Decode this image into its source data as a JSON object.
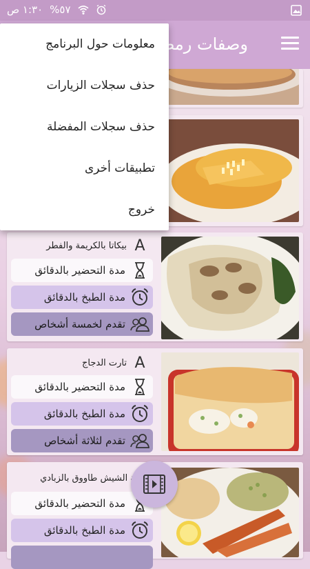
{
  "status_bar": {
    "time": "١:٣٠ ص",
    "battery": "%٥٧"
  },
  "app": {
    "title": "وصفات رمضان"
  },
  "menu": {
    "items": [
      {
        "label": "معلومات حول البرنامج"
      },
      {
        "label": "حذف سجلات الزيارات"
      },
      {
        "label": "حذف سجلات المفضلة"
      },
      {
        "label": "تطبيقات أخرى"
      },
      {
        "label": "خروج"
      }
    ]
  },
  "recipes": [
    {
      "title": "بيكاتا بالكريمة والفطر",
      "prep": "مدة التحضير بالدقائق",
      "cook": "مدة الطبخ بالدقائق",
      "serves": "تقدم لخمسة أشخاص"
    },
    {
      "title": "تارت الدجاج",
      "prep": "مدة التحضير بالدقائق",
      "cook": "مدة الطبخ بالدقائق",
      "serves": "تقدم لثلاثة أشخاص"
    },
    {
      "title": "تتبيلة الشيش طاووق بالزبادي",
      "prep": "مدة التحضير بالدقائق",
      "cook": "مدة الطبخ بالدقائق"
    }
  ],
  "colors": {
    "appbar": "#cfa8d4",
    "statusbar": "#c39bc7",
    "pill_light": "#fbf8fb",
    "pill_mid": "#d5c4ea",
    "pill_dark": "#a597c1"
  }
}
